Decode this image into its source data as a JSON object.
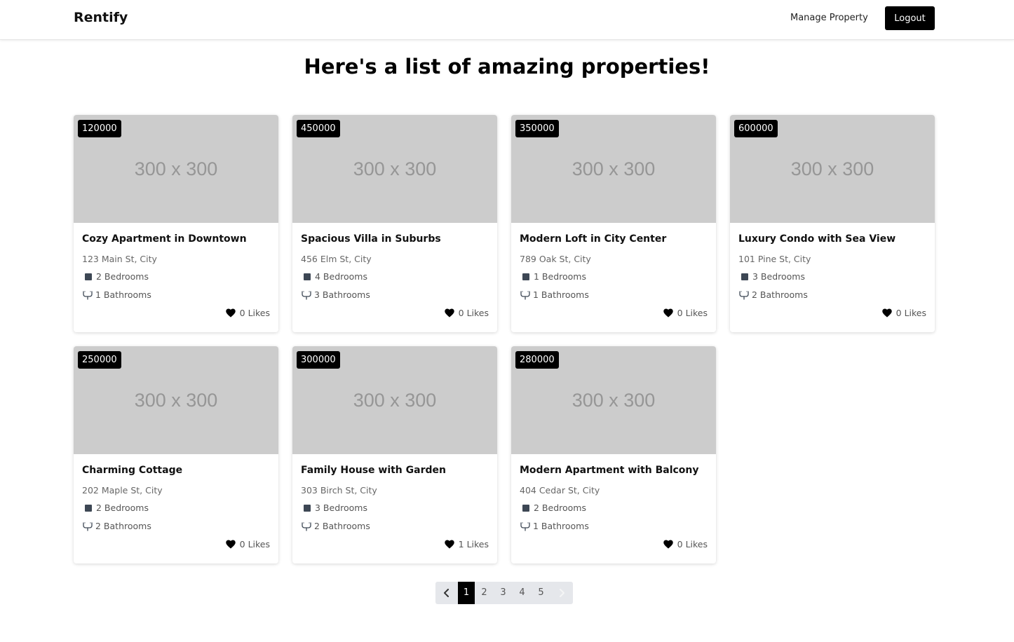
{
  "navbar": {
    "brand": "Rentify",
    "manage_property": "Manage Property",
    "logout": "Logout"
  },
  "page": {
    "title": "Here's a list of amazing properties!"
  },
  "properties": [
    {
      "price": "120000",
      "image_text": "300 x 300",
      "title": "Cozy Apartment in Downtown",
      "address": "123 Main St, City",
      "bedrooms": "2 Bedrooms",
      "bathrooms": "1 Bathrooms",
      "likes": "0 Likes"
    },
    {
      "price": "450000",
      "image_text": "300 x 300",
      "title": "Spacious Villa in Suburbs",
      "address": "456 Elm St, City",
      "bedrooms": "4 Bedrooms",
      "bathrooms": "3 Bathrooms",
      "likes": "0 Likes"
    },
    {
      "price": "350000",
      "image_text": "300 x 300",
      "title": "Modern Loft in City Center",
      "address": "789 Oak St, City",
      "bedrooms": "1 Bedrooms",
      "bathrooms": "1 Bathrooms",
      "likes": "0 Likes"
    },
    {
      "price": "600000",
      "image_text": "300 x 300",
      "title": "Luxury Condo with Sea View",
      "address": "101 Pine St, City",
      "bedrooms": "3 Bedrooms",
      "bathrooms": "2 Bathrooms",
      "likes": "0 Likes"
    },
    {
      "price": "250000",
      "image_text": "300 x 300",
      "title": "Charming Cottage",
      "address": "202 Maple St, City",
      "bedrooms": "2 Bedrooms",
      "bathrooms": "2 Bathrooms",
      "likes": "0 Likes"
    },
    {
      "price": "300000",
      "image_text": "300 x 300",
      "title": "Family House with Garden",
      "address": "303 Birch St, City",
      "bedrooms": "3 Bedrooms",
      "bathrooms": "2 Bathrooms",
      "likes": "1 Likes"
    },
    {
      "price": "280000",
      "image_text": "300 x 300",
      "title": "Modern Apartment with Balcony",
      "address": "404 Cedar St, City",
      "bedrooms": "2 Bedrooms",
      "bathrooms": "1 Bathrooms",
      "likes": "0 Likes"
    }
  ],
  "pagination": {
    "pages": [
      "1",
      "2",
      "3",
      "4",
      "5"
    ],
    "current": "1",
    "prev_icon": "chevron-left-icon",
    "next_icon": "chevron-right-icon"
  },
  "icons": {
    "bedroom": "bed-icon",
    "bathroom": "bath-icon",
    "like": "heart-icon"
  },
  "colors": {
    "accent": "#000000",
    "image_placeholder": "#cccccc",
    "pagination_bg": "#e5e7eb"
  }
}
